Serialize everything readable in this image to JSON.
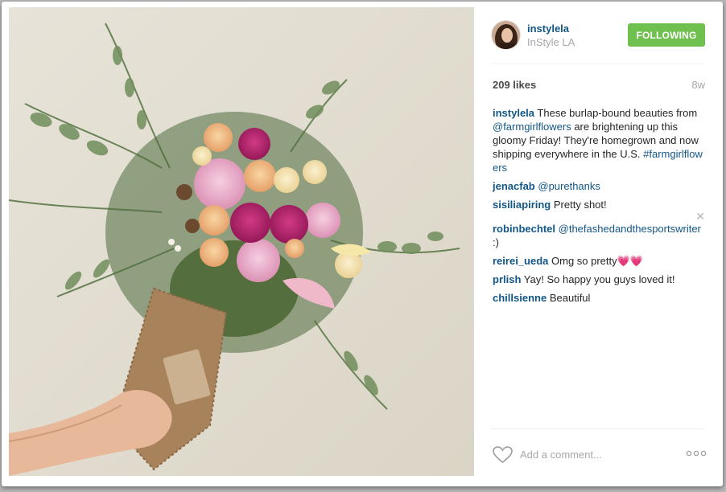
{
  "photo": {
    "description_icon": "flower-bouquet-photo"
  },
  "header": {
    "username": "instylela",
    "location": "InStyle LA",
    "follow_label": "FOLLOWING",
    "follow_color": "#70c050"
  },
  "stats": {
    "likes": "209 likes",
    "age": "8w"
  },
  "caption": {
    "user": "instylela",
    "text_1": "These burlap-bound beauties from ",
    "mention": "@farmgirlflowers",
    "text_2": " are brightening up this gloomy Friday! They're homegrown and now shipping everywhere in the U.S. ",
    "hashtag": "#farmgirlflowers"
  },
  "comments": [
    {
      "user": "jenacfab",
      "mention": "@purethanks",
      "text": ""
    },
    {
      "user": "sisiliapiring",
      "mention": "",
      "text": "Pretty shot!"
    },
    {
      "user": "robinbechtel",
      "mention": "@thefashedandthesportswriter",
      "text": " :)"
    },
    {
      "user": "reirei_ueda",
      "mention": "",
      "text": "Omg so pretty",
      "emoji": "💗💗"
    },
    {
      "user": "prlish",
      "mention": "",
      "text": "Yay! So happy you guys loved it!"
    },
    {
      "user": "chillsienne",
      "mention": "",
      "text": "Beautiful"
    }
  ],
  "footer": {
    "comment_placeholder": "Add a comment..."
  },
  "colors": {
    "link": "#125688",
    "muted": "#a5a7aa",
    "accent": "#70c050"
  }
}
